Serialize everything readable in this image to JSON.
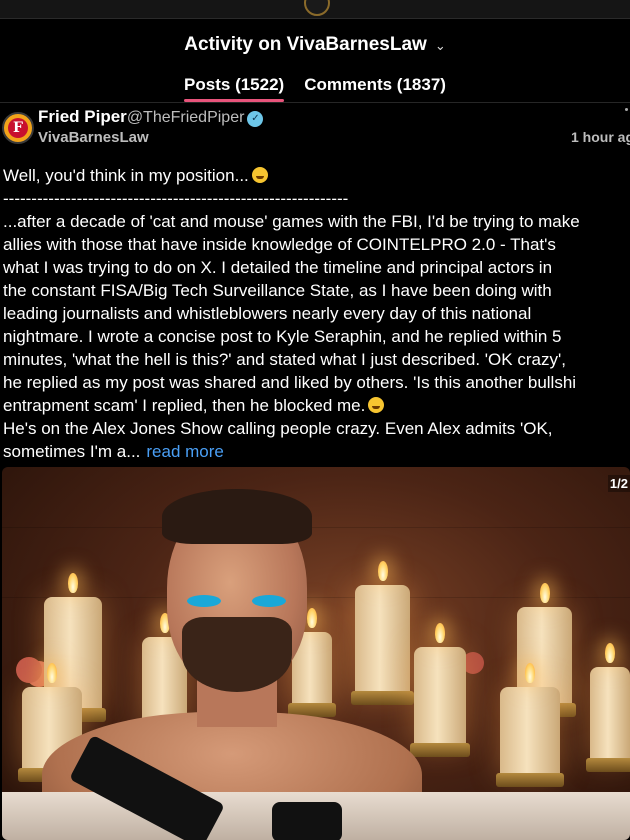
{
  "header": {
    "title": "Activity on VivaBarnesLaw",
    "chevron_icon": "chevron-down-icon"
  },
  "tabs": [
    {
      "label": "Posts (1522)",
      "active": true
    },
    {
      "label": "Comments (1837)",
      "active": false
    }
  ],
  "post": {
    "author_name": "Fried Piper",
    "author_handle": "@TheFriedPiper",
    "community": "VivaBarnesLaw",
    "timestamp": "1 hour ag",
    "body_lines": [
      "Well, you'd think in my position...",
      "-------------------------------------------------------------",
      "...after a decade of 'cat and mouse' games with the FBI, I'd be trying to make",
      "allies with those that have inside knowledge of COINTELPRO 2.0 - That's",
      "what I was trying to do on X. I detailed the timeline and principal actors in",
      "the constant FISA/Big Tech Surveillance State, as I have been doing with",
      "leading journalists and whistleblowers nearly every day of this national",
      "nightmare. I wrote a concise post to Kyle Seraphin, and he replied within 5",
      "minutes, 'what the hell is this?' and stated what I just described. 'OK crazy',",
      "he replied as my post was shared and liked by others. 'Is this another bullshi",
      "entrapment scam' I replied, then he blocked me.",
      "He's on the Alex Jones Show calling people crazy. Even Alex admits 'OK,",
      "sometimes I'm a..."
    ],
    "read_more": "read more",
    "media_counter": "1/2"
  },
  "colors": {
    "background": "#000000",
    "tab_underline": "#e8547b",
    "link": "#4a9ff5",
    "muted_text": "#bdbdbd"
  }
}
